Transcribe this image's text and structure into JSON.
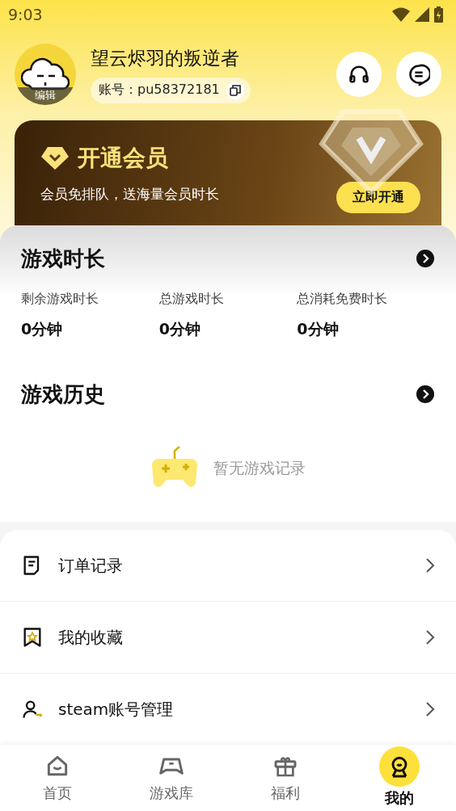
{
  "status_bar": {
    "time": "9:03"
  },
  "profile": {
    "name": "望云烬羽的叛逆者",
    "account_label": "账号：",
    "account": "pu58372181",
    "avatar_badge": "编辑"
  },
  "vip": {
    "title": "开通会员",
    "subtitle": "会员免排队，送海量会员时长",
    "button": "立即开通"
  },
  "playtime": {
    "title": "游戏时长",
    "stats": [
      {
        "label": "剩余游戏时长",
        "value": "0分钟"
      },
      {
        "label": "总游戏时长",
        "value": "0分钟"
      },
      {
        "label": "总消耗免费时长",
        "value": "0分钟"
      }
    ]
  },
  "history": {
    "title": "游戏历史",
    "empty": "暂无游戏记录"
  },
  "menu": [
    {
      "label": "订单记录"
    },
    {
      "label": "我的收藏"
    },
    {
      "label": "steam账号管理"
    }
  ],
  "nav": [
    {
      "label": "首页",
      "selected": false
    },
    {
      "label": "游戏库",
      "selected": false
    },
    {
      "label": "福利",
      "selected": false
    },
    {
      "label": "我的",
      "selected": true
    }
  ]
}
